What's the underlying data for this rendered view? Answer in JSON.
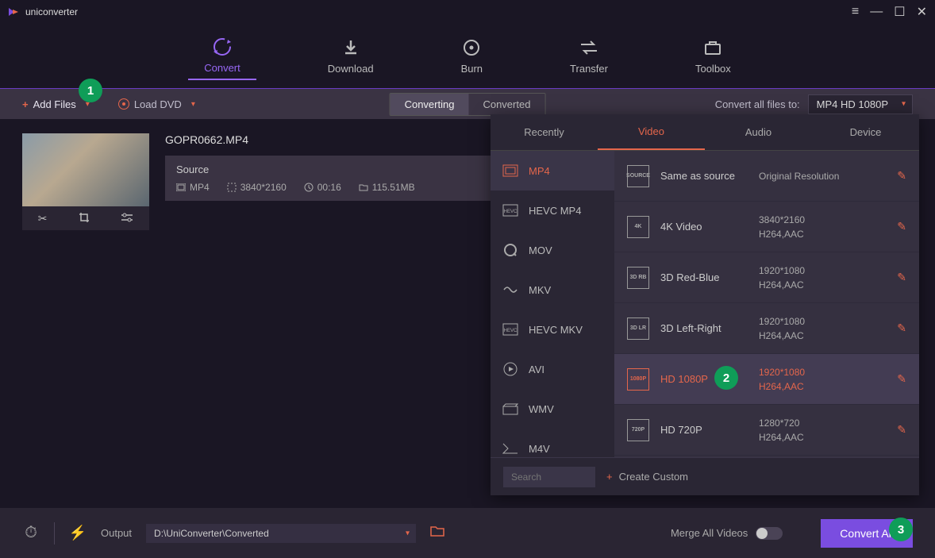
{
  "app": {
    "title": "uniconverter"
  },
  "nav": [
    {
      "key": "convert",
      "label": "Convert"
    },
    {
      "key": "download",
      "label": "Download"
    },
    {
      "key": "burn",
      "label": "Burn"
    },
    {
      "key": "transfer",
      "label": "Transfer"
    },
    {
      "key": "toolbox",
      "label": "Toolbox"
    }
  ],
  "toolbar": {
    "add_files": "Add Files",
    "load_dvd": "Load DVD",
    "converting": "Converting",
    "converted": "Converted",
    "convert_all_to": "Convert all files to:",
    "format_selected": "MP4 HD 1080P"
  },
  "file": {
    "name": "GOPR0662.MP4",
    "source_label": "Source",
    "fmt": "MP4",
    "res": "3840*2160",
    "dur": "00:16",
    "size": "115.51MB"
  },
  "panel": {
    "tabs": [
      "Recently",
      "Video",
      "Audio",
      "Device"
    ],
    "formats": [
      "MP4",
      "HEVC MP4",
      "MOV",
      "MKV",
      "HEVC MKV",
      "AVI",
      "WMV",
      "M4V"
    ],
    "resolutions": [
      {
        "name": "Same as source",
        "det1": "Original Resolution",
        "det2": "",
        "icon": "SOURCE"
      },
      {
        "name": "4K Video",
        "det1": "3840*2160",
        "det2": "H264,AAC",
        "icon": "4K"
      },
      {
        "name": "3D Red-Blue",
        "det1": "1920*1080",
        "det2": "H264,AAC",
        "icon": "3D RB"
      },
      {
        "name": "3D Left-Right",
        "det1": "1920*1080",
        "det2": "H264,AAC",
        "icon": "3D LR"
      },
      {
        "name": "HD 1080P",
        "det1": "1920*1080",
        "det2": "H264,AAC",
        "icon": "1080P"
      },
      {
        "name": "HD 720P",
        "det1": "1280*720",
        "det2": "H264,AAC",
        "icon": "720P"
      }
    ],
    "search_placeholder": "Search",
    "create_custom": "Create Custom"
  },
  "bottom": {
    "output_label": "Output",
    "output_path": "D:\\UniConverter\\Converted",
    "merge": "Merge All Videos",
    "convert_all": "Convert All"
  },
  "badges": {
    "1": "1",
    "2": "2",
    "3": "3"
  }
}
